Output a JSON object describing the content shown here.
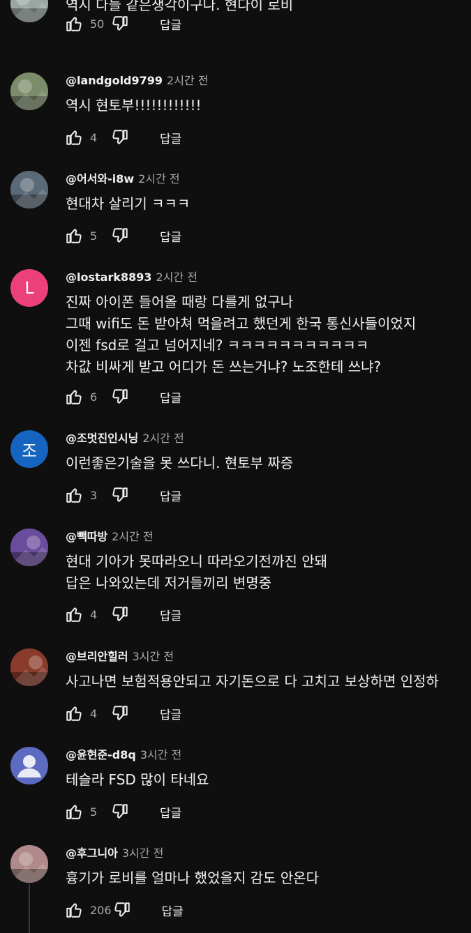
{
  "comments": [
    {
      "avatar": {
        "type": "photo",
        "color": "#9aa7a3",
        "letter": ""
      },
      "author": "",
      "time": "",
      "lines": [
        "역시 다들 같은생각이구나. 현다이 로비"
      ],
      "likes": "50",
      "reply": "답글"
    },
    {
      "avatar": {
        "type": "photo",
        "color": "#7c8b6a",
        "letter": ""
      },
      "author": "@landgold9799",
      "time": "2시간 전",
      "lines": [
        "역시 현토부!!!!!!!!!!!!"
      ],
      "likes": "4",
      "reply": "답글"
    },
    {
      "avatar": {
        "type": "photo",
        "color": "#5b6a78",
        "letter": ""
      },
      "author": "@어서와-i8w",
      "time": "2시간 전",
      "lines": [
        "현대차 살리기 ㅋㅋㅋ"
      ],
      "likes": "5",
      "reply": "답글"
    },
    {
      "avatar": {
        "type": "letter",
        "color": "#ec407a",
        "letter": "L"
      },
      "author": "@lostark8893",
      "time": "2시간 전",
      "lines": [
        "진짜 아이폰 들어올 때랑 다를게 없구나",
        "그때 wifi도 돈 받아쳐 먹을려고 했던게 한국 통신사들이었지",
        "이젠 fsd로 걸고 넘어지네? ㅋㅋㅋㅋㅋㅋㅋㅋㅋㅋㅋ",
        "차값 비싸게 받고 어디가 돈 쓰는거냐? 노조한테 쓰냐?"
      ],
      "likes": "6",
      "reply": "답글"
    },
    {
      "avatar": {
        "type": "letter",
        "color": "#1565c0",
        "letter": "조"
      },
      "author": "@조멋진인시닝",
      "time": "2시간 전",
      "lines": [
        "이런좋은기술을 못 쓰다니. 현토부 짜증"
      ],
      "likes": "3",
      "reply": "답글"
    },
    {
      "avatar": {
        "type": "photo",
        "color": "#6a4c9c",
        "letter": ""
      },
      "author": "@빽따방",
      "time": "2시간 전",
      "lines": [
        "현대 기아가 못따라오니 따라오기전까진 안돼",
        "답은 나와있는데 저거들끼리 변명중"
      ],
      "likes": "4",
      "reply": "답글"
    },
    {
      "avatar": {
        "type": "photo",
        "color": "#8a3a2a",
        "letter": ""
      },
      "author": "@브리안힐러",
      "time": "3시간 전",
      "lines": [
        "사고나면 보험적용안되고 자기돈으로 다 고치고 보상하면 인정하"
      ],
      "likes": "4",
      "reply": "답글"
    },
    {
      "avatar": {
        "type": "default",
        "color": "#5c6bc0",
        "letter": ""
      },
      "author": "@윤현준-d8q",
      "time": "3시간 전",
      "lines": [
        "테슬라 FSD 많이 타네요"
      ],
      "likes": "5",
      "reply": "답글"
    },
    {
      "avatar": {
        "type": "photo",
        "color": "#b08a8a",
        "letter": ""
      },
      "author": "@후그니아",
      "time": "3시간 전",
      "lines": [
        "흉기가 로비를 얼마나 했었을지 감도 안온다"
      ],
      "likes": "206",
      "reply": "답글"
    }
  ]
}
